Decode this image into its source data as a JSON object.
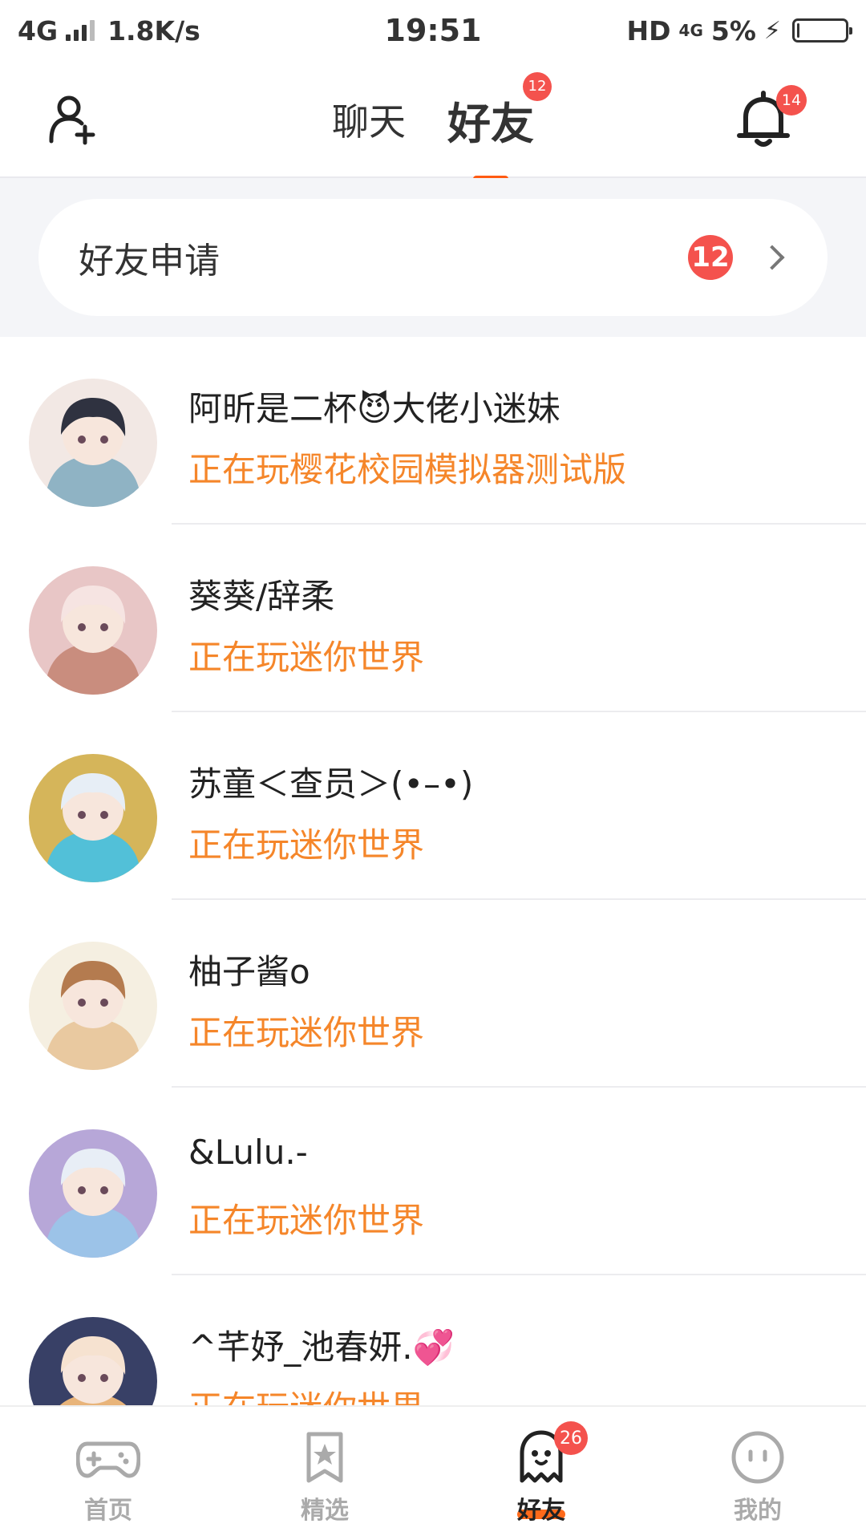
{
  "status_bar": {
    "network": "4G",
    "speed": "1.8K/s",
    "time": "19:51",
    "hd": "HD",
    "net_small": "4G",
    "battery": "5%",
    "battery_level": 0.05
  },
  "header": {
    "add_friend_icon": "person-add-icon",
    "tabs": [
      {
        "label": "聊天",
        "active": false
      },
      {
        "label": "好友",
        "active": true,
        "badge": "12"
      }
    ],
    "bell_icon": "bell-icon",
    "bell_badge": "14",
    "accent_color": "#ff5a12"
  },
  "friend_request": {
    "label": "好友申请",
    "count": "12"
  },
  "friends": [
    {
      "name": "阿昕是二杯😈大佬小迷妹",
      "status": "正在玩樱花校园模拟器测试版",
      "avatar_colors": [
        "#8fb3c4",
        "#2f3240",
        "#f2e8e4"
      ]
    },
    {
      "name": "葵葵/辞柔",
      "status": "正在玩迷你世界",
      "avatar_colors": [
        "#c98d7e",
        "#f6e4e2",
        "#e8c6c6"
      ]
    },
    {
      "name": "苏童＜查员＞(•–•)",
      "status": "正在玩迷你世界",
      "avatar_colors": [
        "#52c0d8",
        "#e7eef6",
        "#d5b55a"
      ]
    },
    {
      "name": "柚子酱o",
      "status": "正在玩迷你世界",
      "avatar_colors": [
        "#e9c9a0",
        "#b47b4f",
        "#f5efe1"
      ]
    },
    {
      "name": "&Lulu.-",
      "status": "正在玩迷你世界",
      "avatar_colors": [
        "#9cc3e8",
        "#e8eef6",
        "#b7a7d8"
      ]
    },
    {
      "name": "^芊妤_池春妍.💞",
      "status": "正在玩迷你世界",
      "avatar_colors": [
        "#e8b47a",
        "#f6e2d0",
        "#384066"
      ]
    }
  ],
  "bottom_nav": [
    {
      "label": "首页",
      "icon": "gamepad-icon",
      "active": false
    },
    {
      "label": "精选",
      "icon": "star-bookmark-icon",
      "active": false
    },
    {
      "label": "好友",
      "icon": "ghost-icon",
      "active": true,
      "badge": "26"
    },
    {
      "label": "我的",
      "icon": "face-icon",
      "active": false
    }
  ],
  "colors": {
    "badge": "#f4524d",
    "status_text": "#f5862a",
    "section_bg": "#f4f5f8"
  }
}
